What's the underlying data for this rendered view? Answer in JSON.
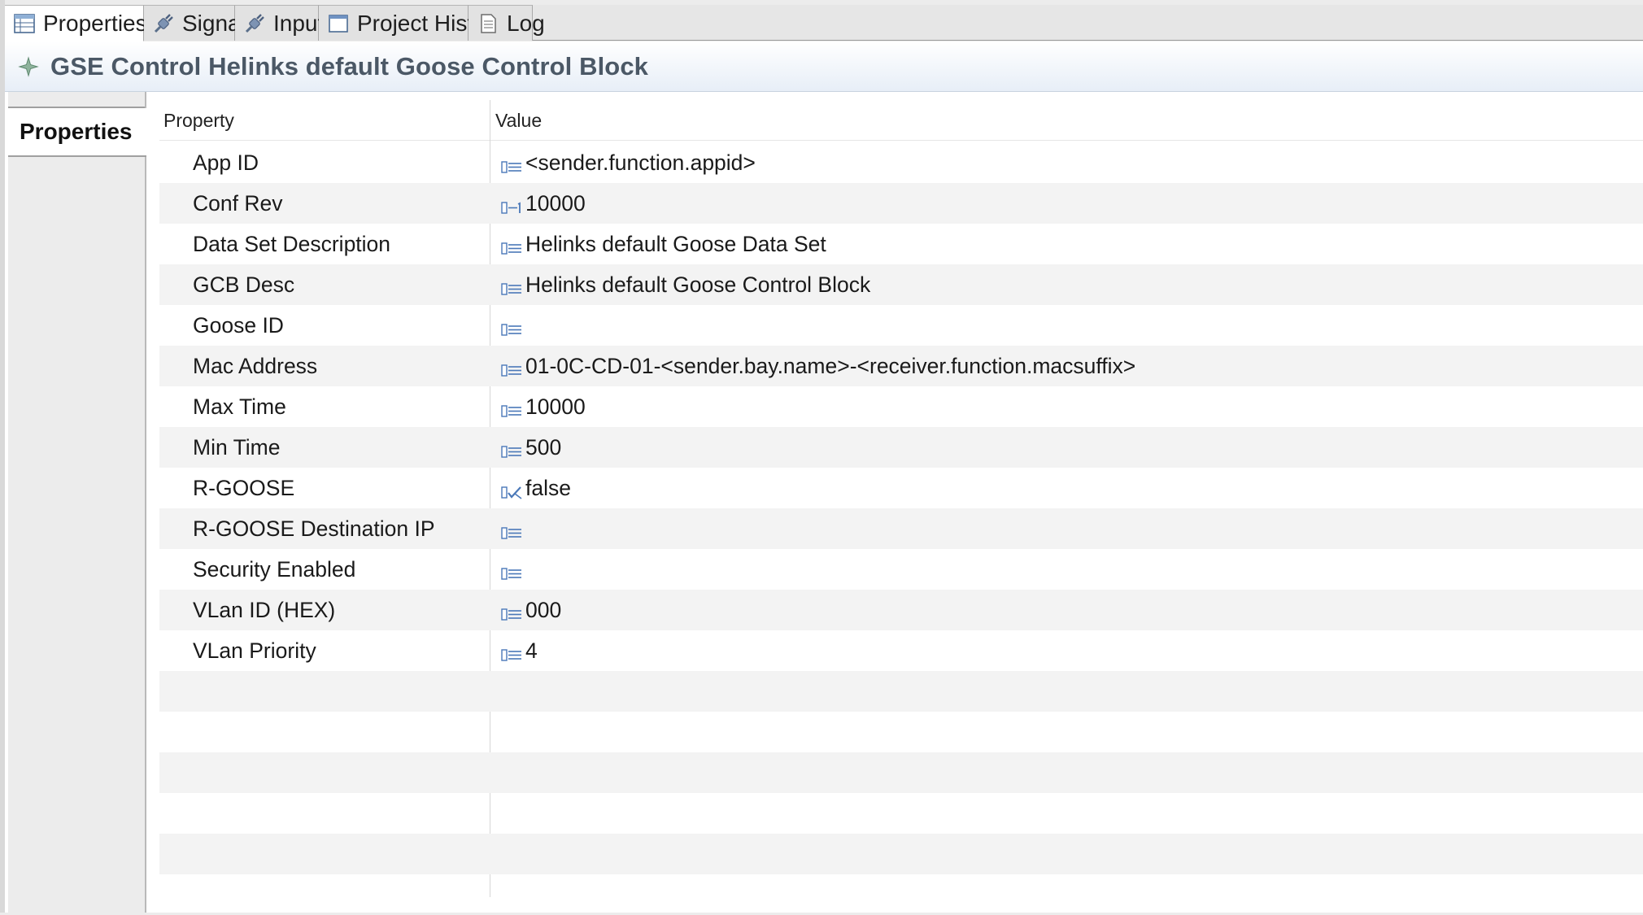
{
  "tabs": [
    {
      "label": "Properties",
      "icon": "table-icon",
      "active": true,
      "closable": true
    },
    {
      "label": "Signals",
      "icon": "plug-icon"
    },
    {
      "label": "Inputs",
      "icon": "plug-icon"
    },
    {
      "label": "Project History",
      "icon": "window-icon"
    },
    {
      "label": "Log",
      "icon": "document-icon"
    }
  ],
  "header": {
    "title": "GSE Control Helinks default Goose Control Block",
    "icon": "element-icon"
  },
  "sidebar": {
    "section_label": "Properties"
  },
  "table": {
    "columns": {
      "property": "Property",
      "value": "Value"
    },
    "rows": [
      {
        "property": "App ID",
        "value": "<sender.function.appid>",
        "icon": "text-field-icon"
      },
      {
        "property": "Conf Rev",
        "value": "10000",
        "icon": "number-field-icon"
      },
      {
        "property": "Data Set Description",
        "value": "Helinks default Goose Data Set",
        "icon": "text-field-icon"
      },
      {
        "property": "GCB Desc",
        "value": "Helinks default Goose Control Block",
        "icon": "text-field-icon"
      },
      {
        "property": "Goose ID",
        "value": "",
        "icon": "text-field-icon"
      },
      {
        "property": "Mac Address",
        "value": "01-0C-CD-01-<sender.bay.name>-<receiver.function.macsuffix>",
        "icon": "text-field-icon"
      },
      {
        "property": "Max Time",
        "value": "10000",
        "icon": "text-field-icon"
      },
      {
        "property": "Min Time",
        "value": "500",
        "icon": "text-field-icon"
      },
      {
        "property": "R-GOOSE",
        "value": "false",
        "icon": "boolean-field-icon"
      },
      {
        "property": "R-GOOSE Destination IP",
        "value": "",
        "icon": "text-field-icon"
      },
      {
        "property": "Security Enabled",
        "value": "",
        "icon": "text-field-icon"
      },
      {
        "property": "VLan ID (HEX)",
        "value": "000",
        "icon": "text-field-icon"
      },
      {
        "property": "VLan Priority",
        "value": "4",
        "icon": "text-field-icon"
      }
    ]
  },
  "colors": {
    "title_text": "#4b5866",
    "row_stripe": "#f3f3f3",
    "icon_blue": "#4a78b8",
    "title_gradient_end": "#e7eef7"
  }
}
